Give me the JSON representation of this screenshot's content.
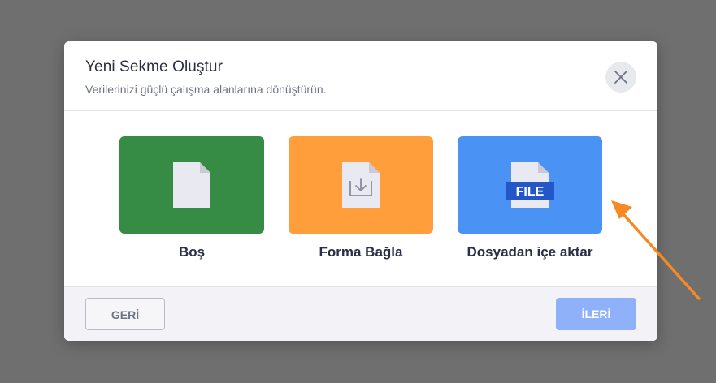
{
  "dialog": {
    "title": "Yeni Sekme Oluştur",
    "subtitle": "Verilerinizi güçlü çalışma alanlarına dönüştürün.",
    "close_icon": "close-icon"
  },
  "options": [
    {
      "label": "Boş",
      "icon": "blank-document-icon",
      "color": "#368c45"
    },
    {
      "label": "Forma Bağla",
      "icon": "document-download-icon",
      "color": "#ff9e3a"
    },
    {
      "label": "Dosyadan içe aktar",
      "icon": "file-import-icon",
      "badge": "FILE",
      "color": "#4a93f5"
    }
  ],
  "footer": {
    "back_label": "GERİ",
    "next_label": "İLERİ"
  },
  "colors": {
    "overlay": "#6f6f6f",
    "next_button": "#8fb1f9",
    "annotation_arrow": "#f58a24"
  }
}
